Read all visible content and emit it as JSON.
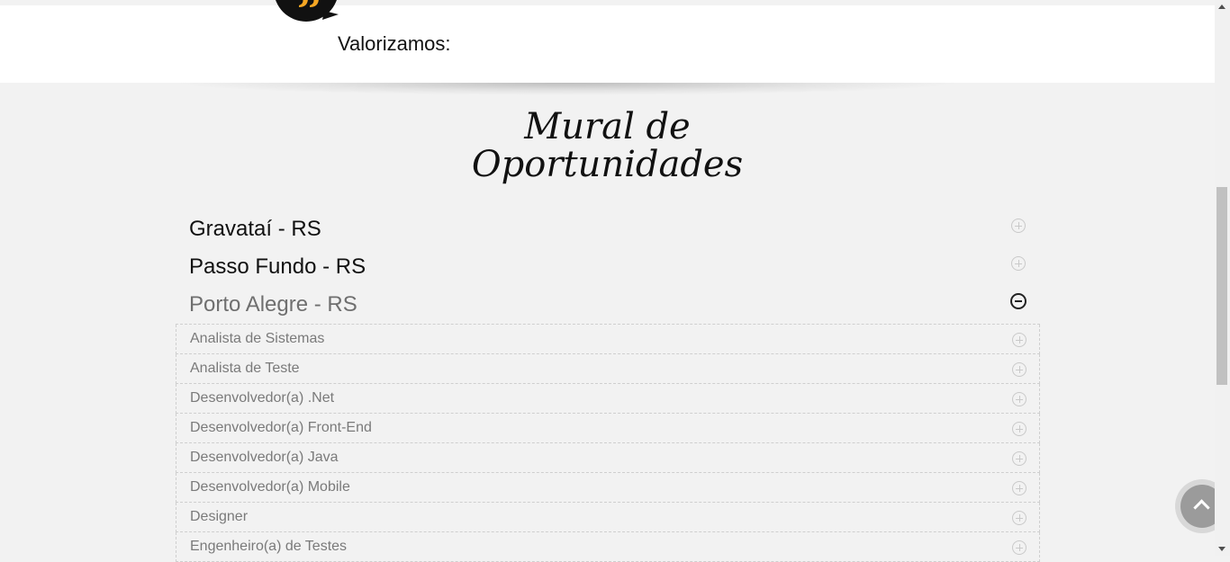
{
  "header": {
    "valorizamos": "Valorizamos:"
  },
  "mural": {
    "title_line1": "Mural de",
    "title_line2": "Oportunidades"
  },
  "cities": [
    {
      "label": "Gravataí - RS",
      "state": "collapsed"
    },
    {
      "label": "Passo Fundo - RS",
      "state": "collapsed"
    },
    {
      "label": "Porto Alegre - RS",
      "state": "expanded"
    }
  ],
  "jobs": [
    "Analista de Sistemas",
    "Analista de Teste",
    "Desenvolvedor(a) .Net",
    "Desenvolvedor(a) Front-End",
    "Desenvolvedor(a) Java",
    "Desenvolvedor(a) Mobile",
    "Designer",
    "Engenheiro(a) de Testes"
  ],
  "icons": {
    "expand": "plus-circle-icon",
    "collapse": "minus-circle-icon",
    "back_to_top": "chevron-up-icon",
    "quote": "quote-bubble-icon"
  },
  "colors": {
    "accent": "#f5a623",
    "bubble": "#111111"
  }
}
